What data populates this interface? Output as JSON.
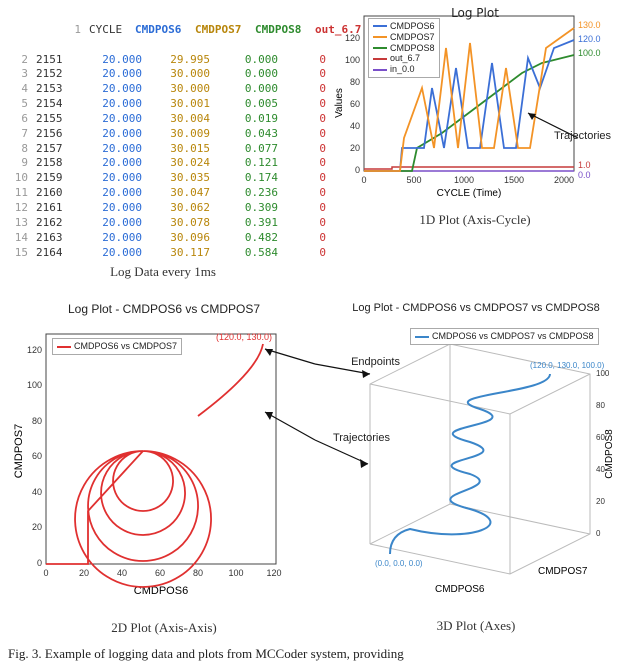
{
  "log_table": {
    "headers": [
      "CYCLE",
      "CMDPOS6",
      "CMDPOS7",
      "CMDPOS8",
      "out_6.7"
    ],
    "header_classes": [
      "c-h0",
      "c-h1",
      "c-h2",
      "c-h3",
      "c-h4"
    ],
    "value_classes": [
      "v0",
      "v1",
      "v2",
      "v3",
      "v4"
    ],
    "rows": [
      {
        "ln": 1,
        "cells": [
          "",
          "",
          "",
          "",
          ""
        ],
        "is_header": true
      },
      {
        "ln": 2,
        "cells": [
          "2151",
          "20.000",
          "29.995",
          "0.000",
          "0"
        ]
      },
      {
        "ln": 3,
        "cells": [
          "2152",
          "20.000",
          "30.000",
          "0.000",
          "0"
        ]
      },
      {
        "ln": 4,
        "cells": [
          "2153",
          "20.000",
          "30.000",
          "0.000",
          "0"
        ]
      },
      {
        "ln": 5,
        "cells": [
          "2154",
          "20.000",
          "30.001",
          "0.005",
          "0"
        ]
      },
      {
        "ln": 6,
        "cells": [
          "2155",
          "20.000",
          "30.004",
          "0.019",
          "0"
        ]
      },
      {
        "ln": 7,
        "cells": [
          "2156",
          "20.000",
          "30.009",
          "0.043",
          "0"
        ]
      },
      {
        "ln": 8,
        "cells": [
          "2157",
          "20.000",
          "30.015",
          "0.077",
          "0"
        ]
      },
      {
        "ln": 9,
        "cells": [
          "2158",
          "20.000",
          "30.024",
          "0.121",
          "0"
        ]
      },
      {
        "ln": 10,
        "cells": [
          "2159",
          "20.000",
          "30.035",
          "0.174",
          "0"
        ]
      },
      {
        "ln": 11,
        "cells": [
          "2160",
          "20.000",
          "30.047",
          "0.236",
          "0"
        ]
      },
      {
        "ln": 12,
        "cells": [
          "2161",
          "20.000",
          "30.062",
          "0.309",
          "0"
        ]
      },
      {
        "ln": 13,
        "cells": [
          "2162",
          "20.000",
          "30.078",
          "0.391",
          "0"
        ]
      },
      {
        "ln": 14,
        "cells": [
          "2163",
          "20.000",
          "30.096",
          "0.482",
          "0"
        ]
      },
      {
        "ln": 15,
        "cells": [
          "2164",
          "20.000",
          "30.117",
          "0.584",
          "0"
        ]
      }
    ]
  },
  "captions": {
    "tl": "Log Data every 1ms",
    "tr": "1D Plot (Axis-Cycle)",
    "bl": "2D Plot (Axis-Axis)",
    "br": "3D Plot (Axes)",
    "fig": "Fig. 3.   Example of logging data and plots from MCCoder system, providing"
  },
  "plot1d": {
    "title": "Log Plot",
    "xlabel": "CYCLE (Time)",
    "ylabel": "Values",
    "legend": [
      "CMDPOS6",
      "CMDPOS7",
      "CMDPOS8",
      "out_6.7",
      "in_0.0"
    ],
    "legend_colors": [
      "#3b6fd6",
      "#f39326",
      "#2e8b2e",
      "#c63a3a",
      "#7a4fc9"
    ],
    "xticks": [
      "0",
      "500",
      "1000",
      "1500",
      "2000"
    ],
    "yticks": [
      "0",
      "20",
      "40",
      "60",
      "80",
      "100",
      "120"
    ],
    "endlabels": [
      {
        "text": "130.0",
        "color": "#f39326"
      },
      {
        "text": "120.0",
        "color": "#3b6fd6"
      },
      {
        "text": "100.0",
        "color": "#2e8b2e"
      },
      {
        "text": "1.0",
        "color": "#c63a3a"
      },
      {
        "text": "0.0",
        "color": "#7a4fc9"
      }
    ],
    "annot": "Trajectories"
  },
  "plot2d": {
    "title": "Log Plot - CMDPOS6 vs CMDPOS7",
    "legend": "CMDPOS6 vs CMDPOS7",
    "legend_color": "#e03030",
    "xlabel": "CMDPOS6",
    "ylabel": "CMDPOS7",
    "xticks": [
      "0",
      "20",
      "40",
      "60",
      "80",
      "100",
      "120"
    ],
    "yticks": [
      "0",
      "20",
      "40",
      "60",
      "80",
      "100",
      "120"
    ],
    "endlabel": "(120.0, 130.0)",
    "annot_ep": "Endpoints",
    "annot_tr": "Trajectories"
  },
  "plot3d": {
    "title": "Log Plot - CMDPOS6 vs CMDPOS7 vs CMDPOS8",
    "legend": "CMDPOS6 vs CMDPOS7 vs CMDPOS8",
    "legend_color": "#3b6fd6",
    "xlabel": "CMDPOS6",
    "ylabel": "CMDPOS7",
    "zlabel": "CMDPOS8",
    "endlabel_top": "(120.0, 130.0, 100.0)",
    "endlabel_bot": "(0.0, 0.0, 0.0)",
    "zticks": [
      "0",
      "20",
      "40",
      "60",
      "80",
      "100"
    ]
  },
  "chart_data": [
    {
      "type": "line",
      "title": "Log Plot",
      "xlabel": "CYCLE (Time)",
      "ylabel": "Values",
      "xlim": [
        0,
        2200
      ],
      "ylim": [
        0,
        130
      ],
      "x_sample": [
        0,
        200,
        400,
        600,
        800,
        1000,
        1200,
        1400,
        1600,
        1800,
        2000,
        2200
      ],
      "series": [
        {
          "name": "CMDPOS6",
          "color": "#3b6fd6",
          "values": [
            0,
            0,
            20,
            20,
            60,
            20,
            80,
            20,
            30,
            80,
            100,
            120
          ]
        },
        {
          "name": "CMDPOS7",
          "color": "#f39326",
          "values": [
            0,
            0,
            30,
            60,
            20,
            100,
            20,
            110,
            20,
            90,
            105,
            130
          ]
        },
        {
          "name": "CMDPOS8",
          "color": "#2e8b2e",
          "values": [
            0,
            0,
            0,
            20,
            35,
            48,
            60,
            70,
            80,
            88,
            95,
            100
          ]
        },
        {
          "name": "out_6.7",
          "color": "#c63a3a",
          "values": [
            1,
            1,
            1,
            1,
            1,
            1,
            1,
            1,
            1,
            1,
            1,
            1
          ]
        },
        {
          "name": "in_0.0",
          "color": "#7a4fc9",
          "values": [
            0,
            0,
            0,
            0,
            0,
            0,
            0,
            0,
            0,
            0,
            0,
            0
          ]
        }
      ]
    },
    {
      "type": "line",
      "title": "Log Plot - CMDPOS6 vs CMDPOS7",
      "xlabel": "CMDPOS6",
      "ylabel": "CMDPOS7",
      "xlim": [
        0,
        130
      ],
      "ylim": [
        0,
        130
      ],
      "note": "2D trajectory spiral ending at (120,130)"
    },
    {
      "type": "line",
      "title": "Log Plot - CMDPOS6 vs CMDPOS7 vs CMDPOS8",
      "xlabel": "CMDPOS6",
      "ylabel": "CMDPOS7",
      "zlabel": "CMDPOS8",
      "note": "3D helix from (0,0,0) to (120,130,100)"
    }
  ]
}
